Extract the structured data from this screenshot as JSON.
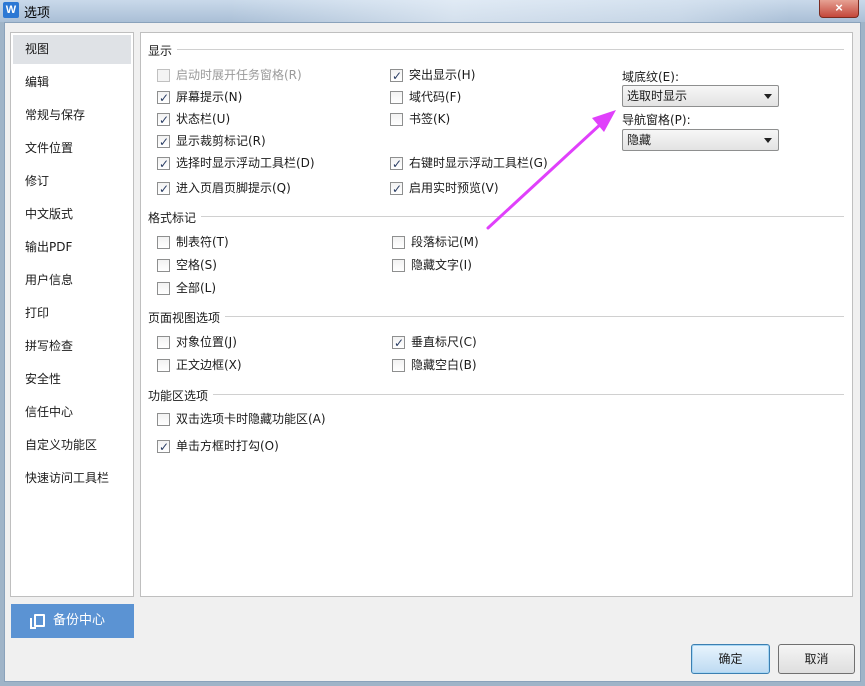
{
  "window": {
    "title": "选项",
    "app_icon": "W",
    "close_label": "×"
  },
  "sidebar": {
    "items": [
      {
        "label": "视图",
        "selected": true
      },
      {
        "label": "编辑"
      },
      {
        "label": "常规与保存"
      },
      {
        "label": "文件位置"
      },
      {
        "label": "修订"
      },
      {
        "label": "中文版式"
      },
      {
        "label": "输出PDF"
      },
      {
        "label": "用户信息"
      },
      {
        "label": "打印"
      },
      {
        "label": "拼写检查"
      },
      {
        "label": "安全性"
      },
      {
        "label": "信任中心"
      },
      {
        "label": "自定义功能区"
      },
      {
        "label": "快速访问工具栏"
      }
    ],
    "backup_label": "备份中心"
  },
  "sections": {
    "display": {
      "title": "显示",
      "left": [
        {
          "label": "启动时展开任务窗格(R)",
          "checked": false,
          "disabled": true
        },
        {
          "label": "屏幕提示(N)",
          "checked": true
        },
        {
          "label": "状态栏(U)",
          "checked": true
        },
        {
          "label": "显示裁剪标记(R)",
          "checked": true
        },
        {
          "label": "选择时显示浮动工具栏(D)",
          "checked": true
        },
        {
          "label": "进入页眉页脚提示(Q)",
          "checked": true
        }
      ],
      "right": [
        {
          "label": "突出显示(H)",
          "checked": true
        },
        {
          "label": "域代码(F)",
          "checked": false
        },
        {
          "label": "书签(K)",
          "checked": false
        },
        {
          "label": "右键时显示浮动工具栏(G)",
          "checked": true
        },
        {
          "label": "启用实时预览(V)",
          "checked": true
        }
      ],
      "field_shading": {
        "label": "域底纹(E):",
        "value": "选取时显示"
      },
      "nav_pane": {
        "label": "导航窗格(P):",
        "value": "隐藏"
      }
    },
    "format_marks": {
      "title": "格式标记",
      "items": [
        {
          "label": "制表符(T)",
          "checked": false
        },
        {
          "label": "段落标记(M)",
          "checked": false
        },
        {
          "label": "空格(S)",
          "checked": false
        },
        {
          "label": "隐藏文字(I)",
          "checked": false
        },
        {
          "label": "全部(L)",
          "checked": false
        }
      ]
    },
    "page_view": {
      "title": "页面视图选项",
      "items": [
        {
          "label": "对象位置(J)",
          "checked": false
        },
        {
          "label": "垂直标尺(C)",
          "checked": true
        },
        {
          "label": "正文边框(X)",
          "checked": false
        },
        {
          "label": "隐藏空白(B)",
          "checked": false
        }
      ]
    },
    "ribbon": {
      "title": "功能区选项",
      "items": [
        {
          "label": "双击选项卡时隐藏功能区(A)",
          "checked": false
        },
        {
          "label": "单击方框时打勾(O)",
          "checked": true
        }
      ]
    }
  },
  "buttons": {
    "ok_label": "确定",
    "cancel_label": "取消"
  },
  "colors": {
    "accent_blue": "#5b93d3",
    "annotation_arrow": "#e040fb"
  }
}
